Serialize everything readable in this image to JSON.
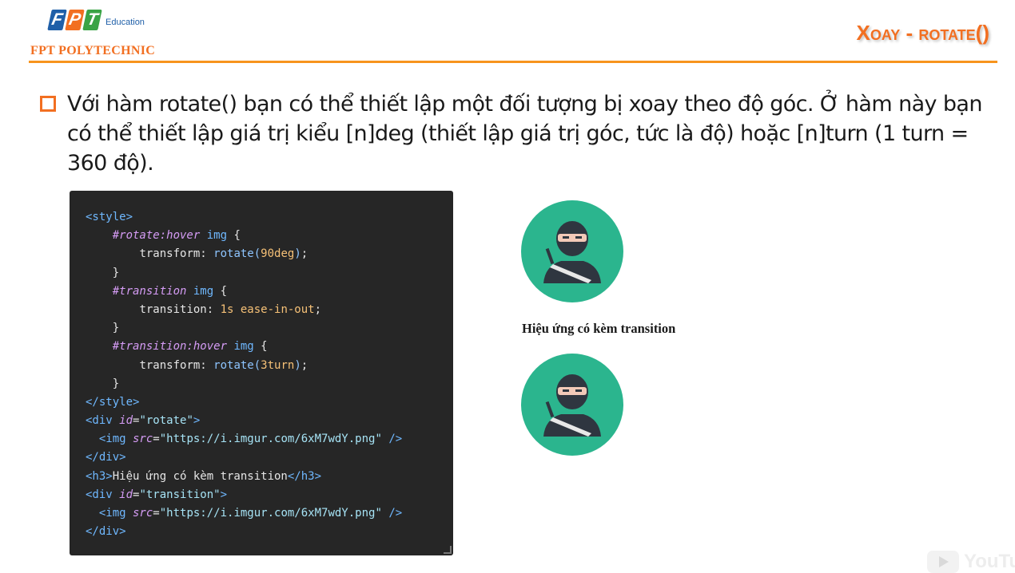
{
  "header": {
    "logo_letters": [
      "F",
      "P",
      "T"
    ],
    "logo_tagline": "Education",
    "school_name": "FPT POLYTECHNIC",
    "slide_title": "Xoay - rotate()"
  },
  "bullet": {
    "text": "Với hàm rotate() bạn có thể thiết lập một đối tượng bị xoay theo độ góc. Ở hàm này bạn có thể thiết lập giá trị kiểu  [n]deg (thiết lập giá trị góc, tức là độ) hoặc [n]turn (1 turn = 360 độ)."
  },
  "code": {
    "lines": [
      [
        {
          "t": "tag",
          "v": "<style>"
        }
      ],
      [
        {
          "t": "punc",
          "v": "    "
        },
        {
          "t": "sel",
          "v": "#rotate:hover"
        },
        {
          "t": "tag",
          "v": " img"
        },
        {
          "t": "punc",
          "v": " {"
        }
      ],
      [
        {
          "t": "punc",
          "v": "        "
        },
        {
          "t": "prop",
          "v": "transform: "
        },
        {
          "t": "fn",
          "v": "rotate("
        },
        {
          "t": "num",
          "v": "90deg"
        },
        {
          "t": "fn",
          "v": ")"
        },
        {
          "t": "punc",
          "v": ";"
        }
      ],
      [
        {
          "t": "punc",
          "v": "    }"
        }
      ],
      [
        {
          "t": "punc",
          "v": "    "
        },
        {
          "t": "sel",
          "v": "#transition"
        },
        {
          "t": "tag",
          "v": " img"
        },
        {
          "t": "punc",
          "v": " {"
        }
      ],
      [
        {
          "t": "punc",
          "v": "        "
        },
        {
          "t": "prop",
          "v": "transition: "
        },
        {
          "t": "num",
          "v": "1s ease-in-out"
        },
        {
          "t": "punc",
          "v": ";"
        }
      ],
      [
        {
          "t": "punc",
          "v": "    }"
        }
      ],
      [
        {
          "t": "punc",
          "v": "    "
        },
        {
          "t": "sel",
          "v": "#transition:hover"
        },
        {
          "t": "tag",
          "v": " img"
        },
        {
          "t": "punc",
          "v": " {"
        }
      ],
      [
        {
          "t": "punc",
          "v": "        "
        },
        {
          "t": "prop",
          "v": "transform: "
        },
        {
          "t": "fn",
          "v": "rotate("
        },
        {
          "t": "num",
          "v": "3turn"
        },
        {
          "t": "fn",
          "v": ")"
        },
        {
          "t": "punc",
          "v": ";"
        }
      ],
      [
        {
          "t": "punc",
          "v": "    }"
        }
      ],
      [
        {
          "t": "tag",
          "v": "</style>"
        }
      ],
      [
        {
          "t": "tag",
          "v": "<div"
        },
        {
          "t": "attr",
          "v": " id"
        },
        {
          "t": "punc",
          "v": "="
        },
        {
          "t": "str",
          "v": "\"rotate\""
        },
        {
          "t": "tag",
          "v": ">"
        }
      ],
      [
        {
          "t": "punc",
          "v": "  "
        },
        {
          "t": "tag",
          "v": "<img"
        },
        {
          "t": "attr",
          "v": " src"
        },
        {
          "t": "punc",
          "v": "="
        },
        {
          "t": "str",
          "v": "\"https://i.imgur.com/6xM7wdY.png\""
        },
        {
          "t": "tag",
          "v": " />"
        }
      ],
      [
        {
          "t": "tag",
          "v": "</div>"
        }
      ],
      [
        {
          "t": "tag",
          "v": "<h3>"
        },
        {
          "t": "punc",
          "v": "Hiệu ứng có kèm transition"
        },
        {
          "t": "tag",
          "v": "</h3>"
        }
      ],
      [
        {
          "t": "tag",
          "v": "<div"
        },
        {
          "t": "attr",
          "v": " id"
        },
        {
          "t": "punc",
          "v": "="
        },
        {
          "t": "str",
          "v": "\"transition\""
        },
        {
          "t": "tag",
          "v": ">"
        }
      ],
      [
        {
          "t": "punc",
          "v": "  "
        },
        {
          "t": "tag",
          "v": "<img"
        },
        {
          "t": "attr",
          "v": " src"
        },
        {
          "t": "punc",
          "v": "="
        },
        {
          "t": "str",
          "v": "\"https://i.imgur.com/6xM7wdY.png\""
        },
        {
          "t": "tag",
          "v": " />"
        }
      ],
      [
        {
          "t": "tag",
          "v": "</div>"
        }
      ]
    ]
  },
  "demo": {
    "heading": "Hiệu ứng có kèm transition",
    "avatar_icon": "ninja-icon",
    "avatar_bg": "#2bb58e"
  },
  "watermark": {
    "text": "YouTu"
  },
  "colors": {
    "accent": "#f26f21",
    "rule": "#f7941d",
    "code_bg": "#262626"
  }
}
